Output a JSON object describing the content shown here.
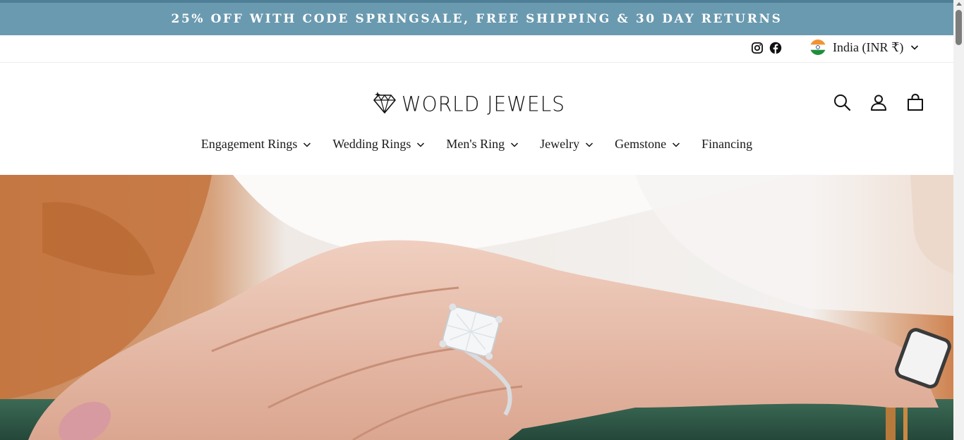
{
  "announcement": {
    "text": "25% OFF WITH CODE SPRINGSALE, FREE SHIPPING & 30 DAY RETURNS"
  },
  "utility": {
    "social": [
      "instagram-icon",
      "facebook-icon"
    ],
    "currency": "India (INR ₹)"
  },
  "brand": {
    "logo_text": "WORLD JEWELS"
  },
  "header_icons": [
    "search-icon",
    "account-icon",
    "cart-icon"
  ],
  "nav": {
    "items": [
      {
        "label": "Engagement Rings",
        "has_dropdown": true
      },
      {
        "label": "Wedding Rings",
        "has_dropdown": true
      },
      {
        "label": "Men's Ring",
        "has_dropdown": true
      },
      {
        "label": "Jewelry",
        "has_dropdown": true
      },
      {
        "label": "Gemstone",
        "has_dropdown": true
      },
      {
        "label": "Financing",
        "has_dropdown": false
      }
    ]
  },
  "colors": {
    "announcement_bg": "#6a9ab0",
    "text": "#1a1a1a"
  }
}
